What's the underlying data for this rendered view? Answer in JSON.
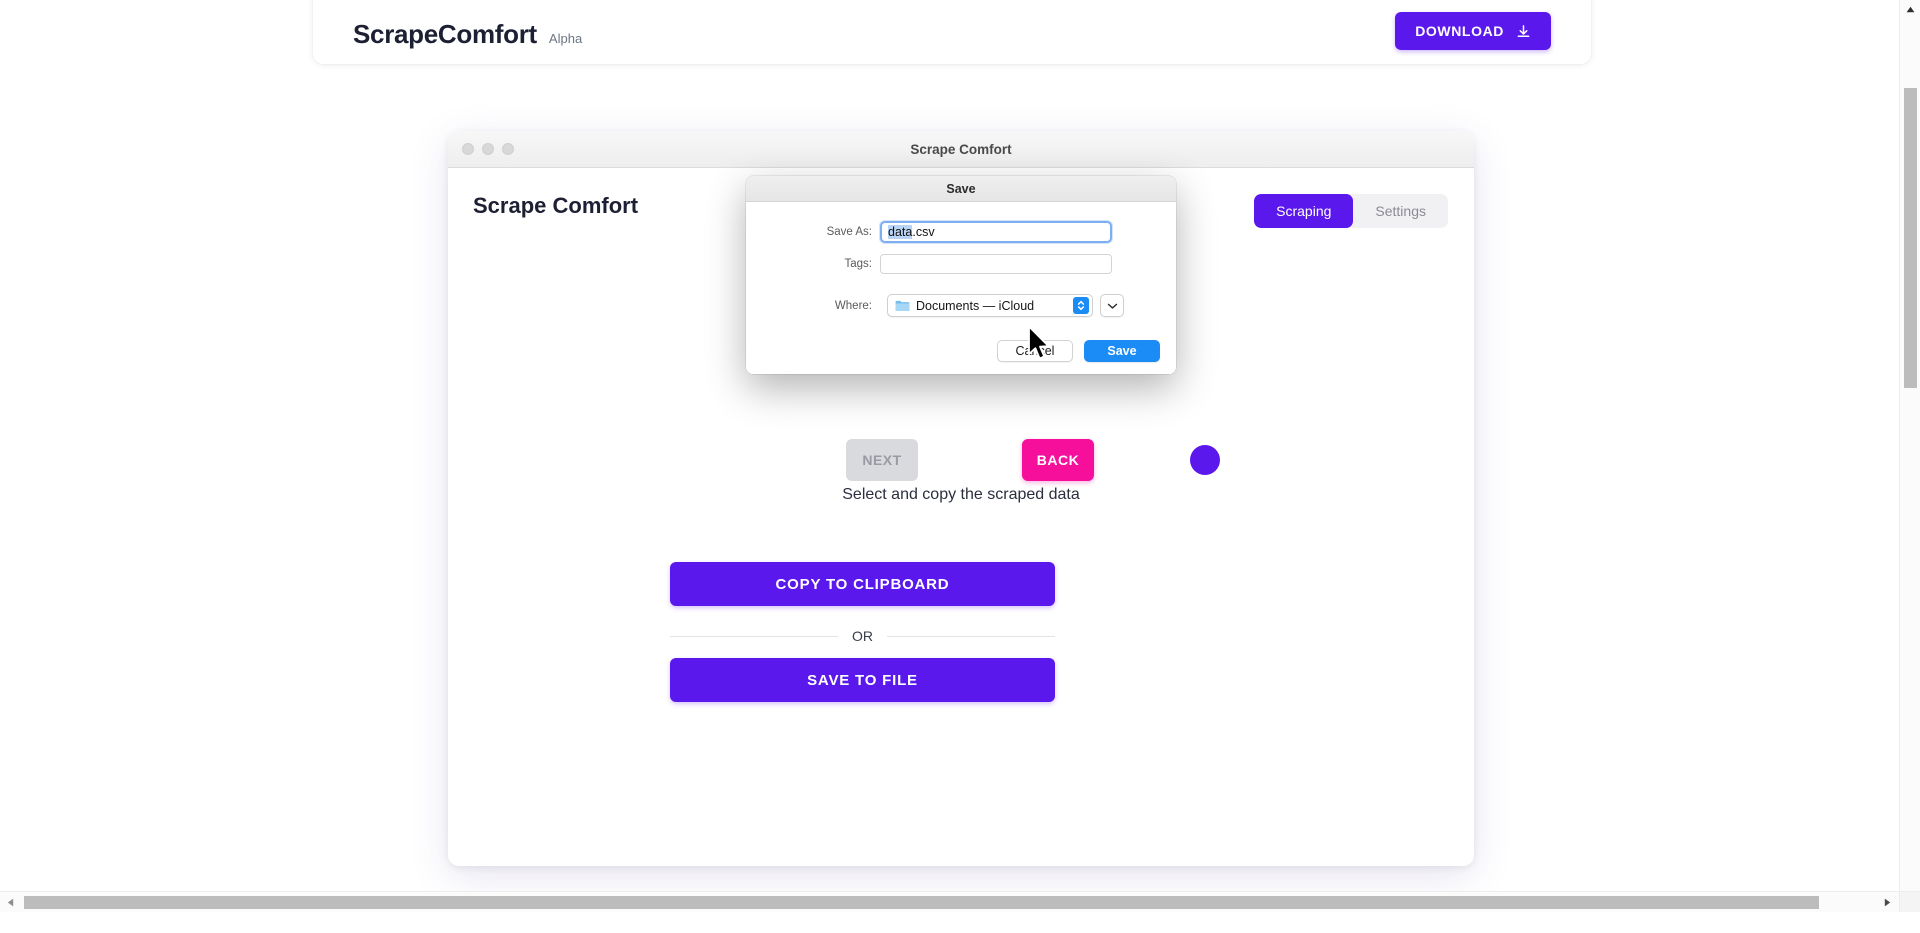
{
  "site_header": {
    "brand_name": "ScrapeComfort",
    "brand_tag": "Alpha",
    "download_label": "DOWNLOAD",
    "download_icon": "download-icon",
    "accent_color": "#5b18ec"
  },
  "app_window": {
    "window_title": "Scrape Comfort",
    "heading": "Scrape Comfort",
    "traffic_lights": [
      "close",
      "minimize",
      "zoom"
    ],
    "tabs": [
      {
        "label": "Scraping",
        "active": true
      },
      {
        "label": "Settings",
        "active": false
      }
    ],
    "stepper": {
      "back_label": "BACK",
      "next_label": "NEXT",
      "caption": "Select and copy the scraped data"
    },
    "actions": {
      "copy_label": "COPY TO CLIPBOARD",
      "or_label": "OR",
      "save_label": "SAVE TO FILE"
    },
    "colors": {
      "primary": "#5b18ec",
      "back": "#f50f9a",
      "next_disabled": "#d9dade"
    }
  },
  "save_sheet": {
    "title": "Save",
    "save_as_label": "Save As:",
    "save_as_value": "data.csv",
    "save_as_selected": "data",
    "save_as_unselected": ".csv",
    "tags_label": "Tags:",
    "tags_value": "",
    "where_label": "Where:",
    "where_value": "Documents — iCloud",
    "where_icon": "folder-icon",
    "stepper_icon": "up-down-chevron-icon",
    "expand_icon": "chevron-down-icon",
    "cancel_label": "Cancel",
    "save_label": "Save",
    "save_button_color": "#1b8cf6"
  },
  "scrollbars": {
    "vertical_up_icon": "triangle-up-icon",
    "horizontal_left_icon": "triangle-left-icon",
    "horizontal_right_icon": "triangle-right-icon"
  },
  "cursor": {
    "icon": "arrow-pointer-icon"
  }
}
